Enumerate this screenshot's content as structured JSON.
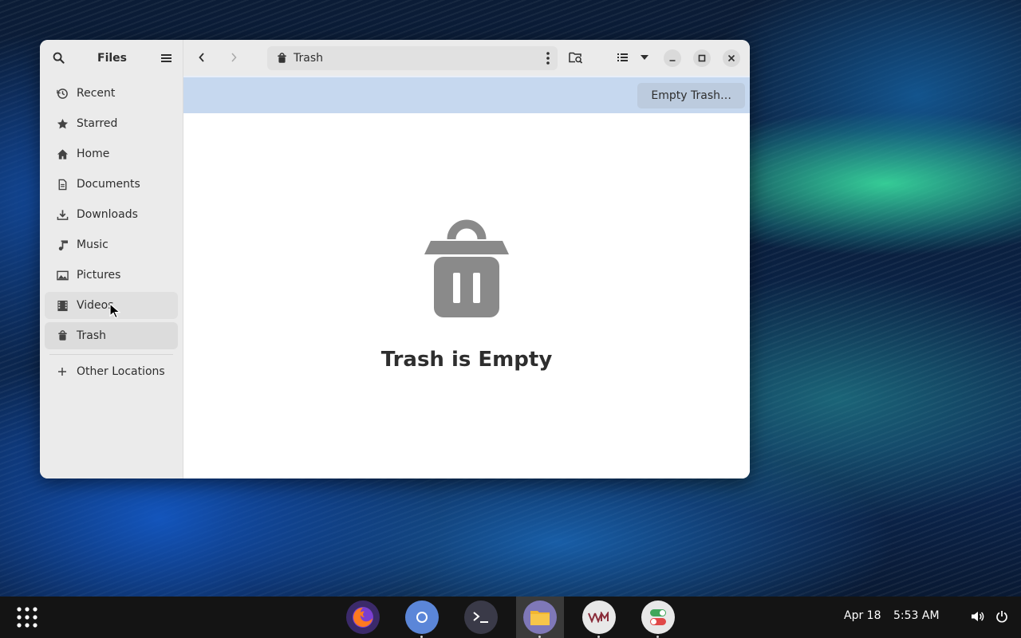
{
  "sidebar": {
    "title": "Files",
    "items": [
      {
        "label": "Recent",
        "icon": "clock-icon"
      },
      {
        "label": "Starred",
        "icon": "star-icon"
      },
      {
        "label": "Home",
        "icon": "home-icon"
      },
      {
        "label": "Documents",
        "icon": "document-icon"
      },
      {
        "label": "Downloads",
        "icon": "download-icon"
      },
      {
        "label": "Music",
        "icon": "music-icon"
      },
      {
        "label": "Pictures",
        "icon": "picture-icon"
      },
      {
        "label": "Videos",
        "icon": "film-icon"
      },
      {
        "label": "Trash",
        "icon": "trash-icon"
      }
    ],
    "other_locations": "Other Locations",
    "selected": "Trash"
  },
  "header": {
    "path_label": "Trash"
  },
  "infobar": {
    "empty_trash_label": "Empty Trash…"
  },
  "content": {
    "empty_title": "Trash is Empty"
  },
  "dock": {
    "apps": [
      "firefox-icon",
      "chromium-icon",
      "terminal-icon",
      "files-icon",
      "vmware-icon",
      "tweaks-icon"
    ],
    "date": "Apr 18",
    "time": "5:53 AM"
  },
  "colors": {
    "infobar": "#c6d8ef",
    "sidebar_bg": "#ebebeb",
    "dock_bg": "#141414"
  }
}
